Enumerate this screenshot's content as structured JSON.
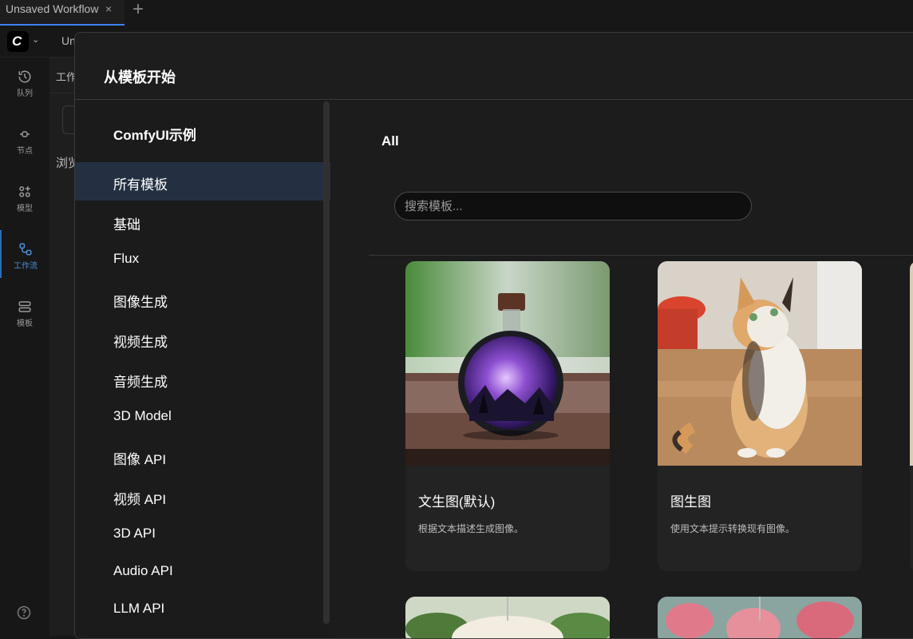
{
  "tab": {
    "title": "Unsaved Workflow",
    "close_glyph": "×",
    "add_glyph": "+"
  },
  "menubar": {
    "menu_peek": "Un"
  },
  "rail": {
    "items": [
      {
        "label": "队列",
        "icon": "history-icon"
      },
      {
        "label": "节点",
        "icon": "node-icon"
      },
      {
        "label": "模型",
        "icon": "model-library-icon"
      },
      {
        "label": "工作流",
        "icon": "workflow-icon",
        "active": true
      },
      {
        "label": "模板",
        "icon": "template-icon"
      }
    ]
  },
  "sidepanel": {
    "title": "工作流",
    "browse": "浏览"
  },
  "modal": {
    "title": "从模板开始",
    "nav_heading": "ComfyUI示例",
    "nav_items": [
      "所有模板",
      "基础",
      "Flux",
      "图像生成",
      "视频生成",
      "音频生成",
      "3D Model",
      "图像 API",
      "视频 API",
      "3D API",
      "Audio API",
      "LLM API"
    ],
    "selected_nav_index": 0,
    "content_title": "All",
    "search_placeholder": "搜索模板...",
    "cards": [
      {
        "title": "文生图(默认)",
        "desc": "根据文本描述生成图像。",
        "image": "bottle-galaxy"
      },
      {
        "title": "图生图",
        "desc": "使用文本提示转换现有图像。",
        "image": "cat"
      }
    ]
  },
  "colors": {
    "accent": "#3b82f6",
    "selected_nav_bg": "#243042",
    "background": "#171717"
  }
}
